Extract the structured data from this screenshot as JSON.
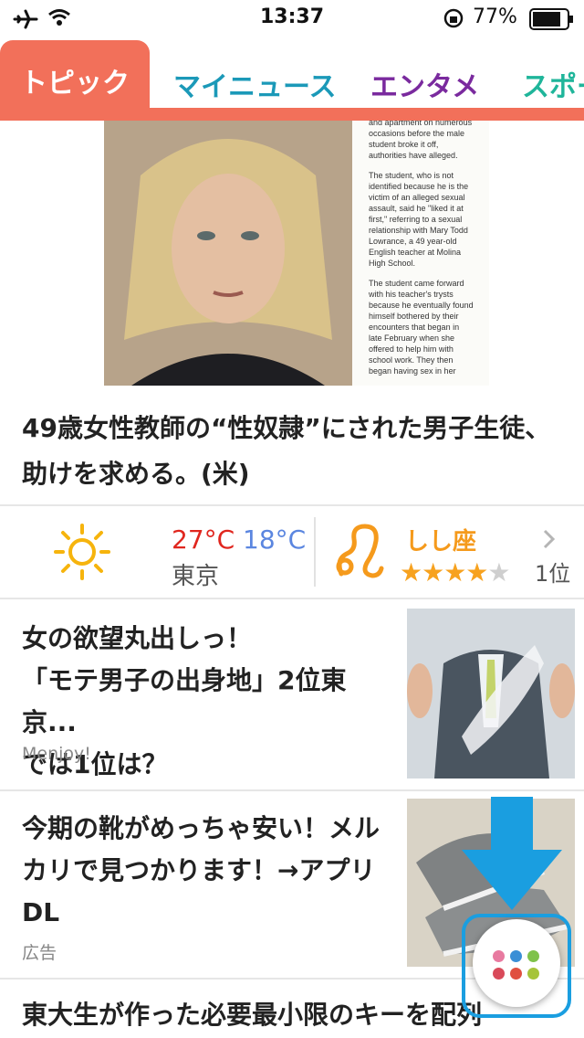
{
  "status_bar": {
    "time": "13:37",
    "battery_percent": "77%"
  },
  "tabs": [
    {
      "label": "トピック",
      "color": "#ffffff",
      "active": true
    },
    {
      "label": "マイニュース",
      "color": "#1b99b8"
    },
    {
      "label": "エンタメ",
      "color": "#7a2a9e"
    },
    {
      "label": "スポー",
      "color": "#1fb59a"
    }
  ],
  "hero": {
    "title": "49歳女性教師の“性奴隷”にされた男子生徒、助けを求める。(米)",
    "doc_text": [
      "and apartment on numerous occasions before the male student broke it off, authorities have alleged.",
      "The student, who is not identified because he is the victim of an alleged sexual assault, said he \"liked it at first,\" referring to a sexual relationship with Mary Todd Lowrance, a 49 year-old English teacher at Molina High School.",
      "The student came forward with his teacher's trysts because he eventually found himself bothered by their encounters that began in late February when she offered to help him with school work. They then began having sex in her"
    ]
  },
  "widget": {
    "weather_icon": "sun-icon",
    "temp_high": "27°C",
    "temp_low": "18°C",
    "city": "東京",
    "horoscope_icon": "leo-icon",
    "horoscope_sign": "しし座",
    "rating": 4.5,
    "rank": "1位"
  },
  "articles": [
    {
      "title_lines": [
        "女の欲望丸出しっ！",
        "「モテ男子の出身地」2位東京...",
        "では1位は？"
      ],
      "source": "Menjoy!"
    },
    {
      "title_lines": [
        "今期の靴がめっちゃ安い！メル",
        "カリで見つかります！→アプリ",
        "DL"
      ],
      "source": "広告"
    },
    {
      "title_lines": [
        "東大生が作った必要最小限のキーを配列"
      ]
    }
  ],
  "colors": {
    "accent": "#f2705a",
    "fab_highlight": "#1a9ee0"
  }
}
